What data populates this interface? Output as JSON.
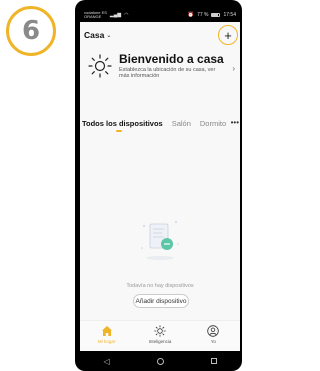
{
  "step": {
    "number": "6"
  },
  "status_bar": {
    "carrier_line1": "vodafone ES",
    "carrier_line2": "ORANGE",
    "right_text": "77 %",
    "time": "17:54"
  },
  "header": {
    "home_label": "Casa",
    "caret": "⌄",
    "add_icon": "plus-icon"
  },
  "weather": {
    "title": "Bienvenido a casa",
    "subtitle": "Establezca la ubicación de su casa, ver más información",
    "icon": "sun-icon"
  },
  "tabs": [
    {
      "label": "Todos los dispositivos",
      "active": true
    },
    {
      "label": "Salón",
      "active": false
    },
    {
      "label": "Dormito",
      "active": false
    }
  ],
  "tabs_more": "•••",
  "empty_state": {
    "message": "Todavía no hay dispositivos",
    "button_label": "Añadir dispositivo"
  },
  "bottom_nav": [
    {
      "label": "Mi hogar",
      "icon": "home-icon",
      "active": true
    },
    {
      "label": "Inteligencia",
      "icon": "sun-icon",
      "active": false
    },
    {
      "label": "Yo",
      "icon": "user-icon",
      "active": false
    }
  ],
  "colors": {
    "accent": "#f0b429",
    "text": "#111111",
    "muted": "#999999"
  }
}
